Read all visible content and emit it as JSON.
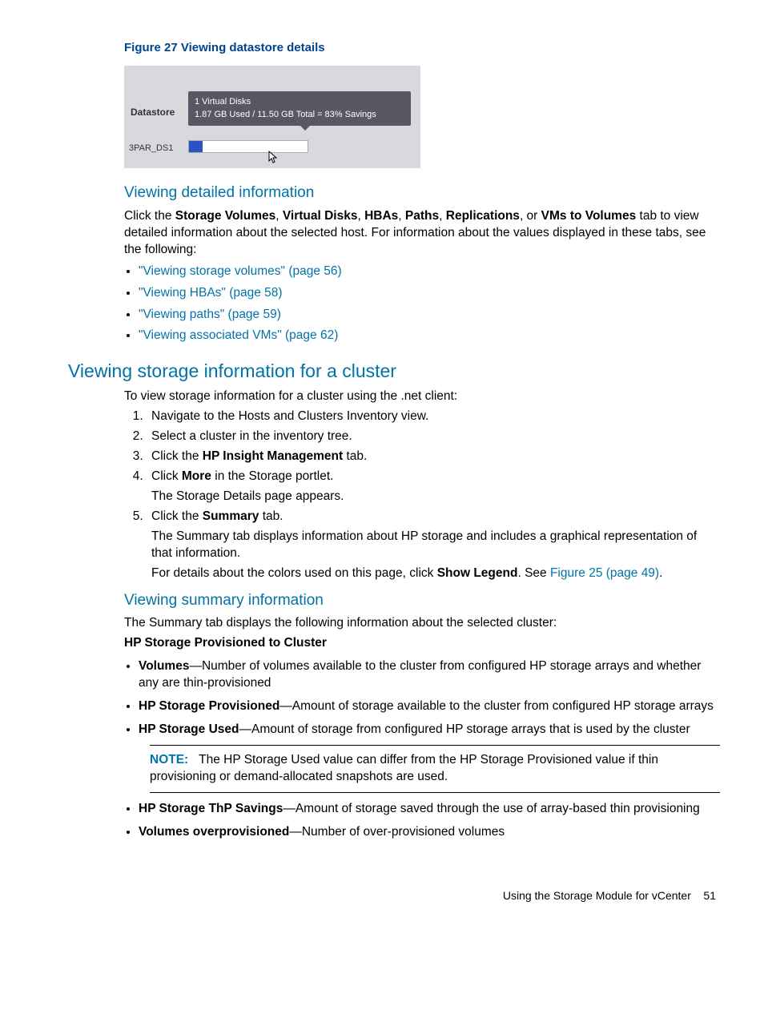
{
  "figure": {
    "caption": "Figure 27 Viewing datastore details",
    "datastore_label": "Datastore",
    "tooltip_line1": "1 Virtual Disks",
    "tooltip_line2": "1.87 GB Used / 11.50 GB Total = 83% Savings",
    "row_label": "3PAR_DS1"
  },
  "sec1": {
    "heading": "Viewing detailed information",
    "intro_pre": "Click the ",
    "tabs": [
      "Storage Volumes",
      "Virtual Disks",
      "HBAs",
      "Paths",
      "Replications",
      "VMs to Volumes"
    ],
    "intro_post": " tab to view detailed information about the selected host. For information about the values displayed in these tabs, see the following:",
    "links": [
      "\"Viewing storage volumes\" (page 56)",
      "\"Viewing HBAs\" (page 58)",
      "\"Viewing paths\" (page 59)",
      "\"Viewing associated VMs\" (page 62)"
    ]
  },
  "sec2": {
    "heading": "Viewing storage information for a cluster",
    "intro": "To view storage information for a cluster using the .net client:",
    "step1": "Navigate to the Hosts and Clusters Inventory view.",
    "step2": "Select a cluster in the inventory tree.",
    "step3_pre": "Click the ",
    "step3_bold": "HP Insight Management",
    "step3_post": " tab.",
    "step4_pre": "Click ",
    "step4_bold": "More",
    "step4_post": " in the Storage portlet.",
    "step4_sub": "The Storage Details page appears.",
    "step5_pre": "Click the ",
    "step5_bold": "Summary",
    "step5_post": " tab.",
    "step5_sub1": "The Summary tab displays information about HP storage and includes a graphical representation of that information.",
    "step5_sub2_pre": "For details about the colors used on this page, click ",
    "step5_sub2_bold": "Show Legend",
    "step5_sub2_mid": ". See ",
    "step5_sub2_link": "Figure 25 (page 49)",
    "step5_sub2_post": "."
  },
  "sec3": {
    "heading": "Viewing summary information",
    "intro": "The Summary tab displays the following information about the selected cluster:",
    "group_heading": "HP Storage Provisioned to Cluster",
    "items": [
      {
        "term": "Volumes",
        "desc": "—Number of volumes available to the cluster from configured HP storage arrays and whether any are thin-provisioned"
      },
      {
        "term": "HP Storage Provisioned",
        "desc": "—Amount of storage available to the cluster from configured HP storage arrays"
      },
      {
        "term": "HP Storage Used",
        "desc": "—Amount of storage from configured HP storage arrays that is used by the cluster"
      }
    ],
    "note_label": "NOTE:",
    "note_text": "The HP Storage Used value can differ from the HP Storage Provisioned value if thin provisioning or demand-allocated snapshots are used.",
    "items2": [
      {
        "term": "HP Storage ThP Savings",
        "desc": "—Amount of storage saved through the use of array-based thin provisioning"
      },
      {
        "term": "Volumes overprovisioned",
        "desc": "—Number of over-provisioned volumes"
      }
    ]
  },
  "footer": {
    "text": "Using the Storage Module for vCenter",
    "page": "51"
  }
}
